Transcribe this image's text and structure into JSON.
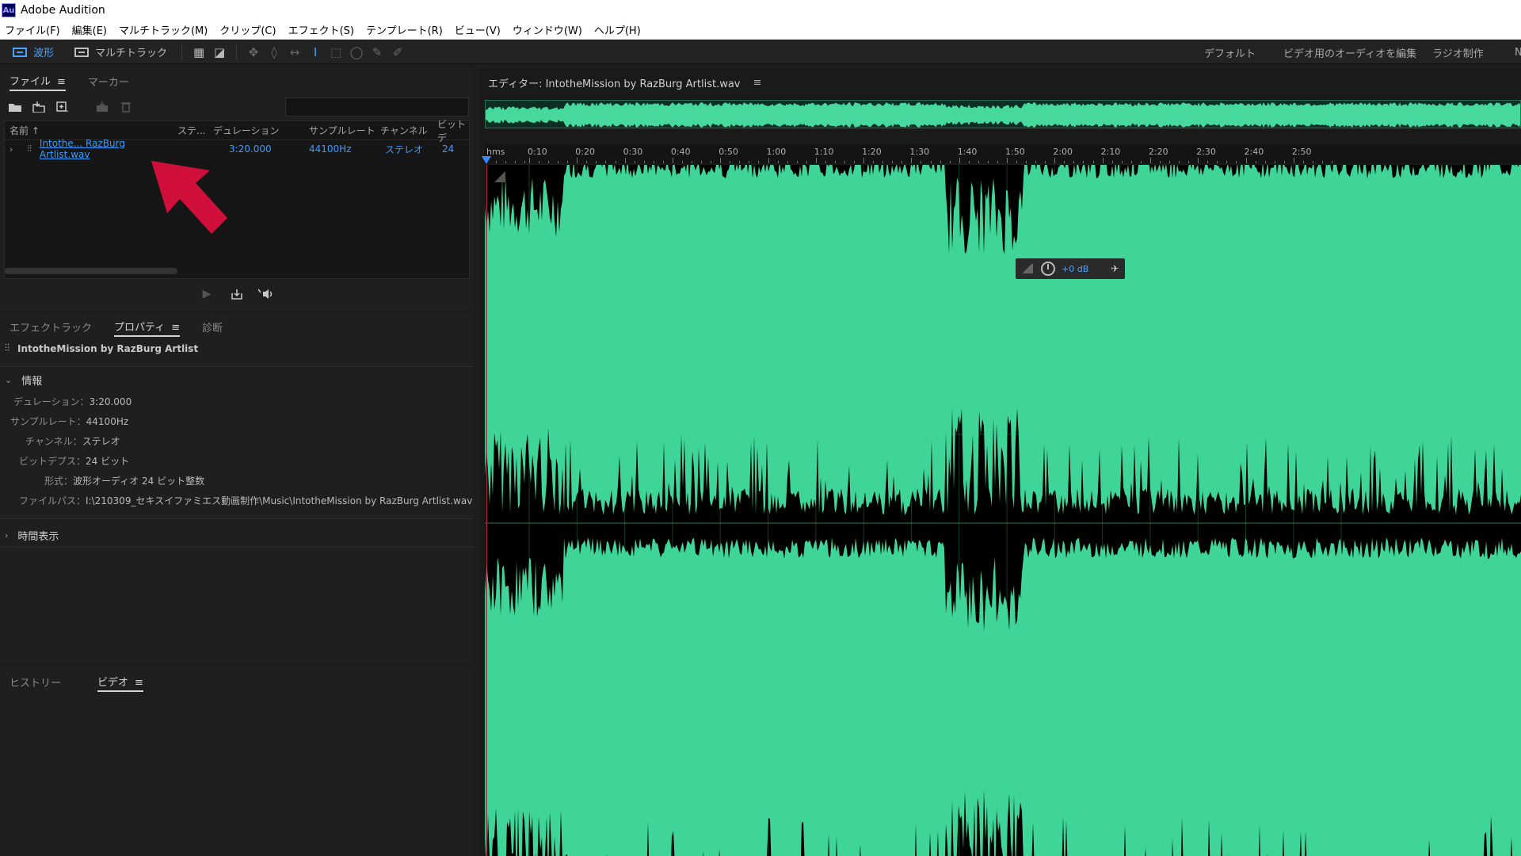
{
  "window": {
    "title": "Adobe Audition",
    "logo_text": "Au"
  },
  "menu": [
    "ファイル(F)",
    "編集(E)",
    "マルチトラック(M)",
    "クリップ(C)",
    "エフェクト(S)",
    "テンプレート(R)",
    "ビュー(V)",
    "ウィンドウ(W)",
    "ヘルプ(H)"
  ],
  "toolbar": {
    "waveform_label": "波形",
    "multitrack_label": "マルチトラック",
    "workspaces": [
      "デフォルト",
      "ビデオ用のオーディオを編集",
      "ラジオ制作",
      "N"
    ]
  },
  "files_panel": {
    "tabs": {
      "files": "ファイル",
      "markers": "マーカー"
    },
    "menu_glyph": "≡",
    "search_placeholder": "",
    "columns": {
      "name": "名前 ↑",
      "status": "ステ...",
      "duration": "デュレーション",
      "sample_rate": "サンプルレート",
      "channels": "チャンネル",
      "bit_depth": "ビットデ"
    },
    "file": {
      "name": "Intothe... RazBurg Artlist.wav",
      "duration": "3:20.000",
      "sample_rate": "44100Hz",
      "channels": "ステレオ",
      "bit_depth": "24"
    }
  },
  "props_panel": {
    "tabs": {
      "effects_rack": "エフェクトラック",
      "properties": "プロパティ",
      "diagnostics": "診断"
    },
    "title": "IntotheMission by RazBurg Artlist",
    "info_header": "情報",
    "rows": [
      {
        "label": "デュレーション：",
        "value": "3:20.000"
      },
      {
        "label": "サンプルレート：",
        "value": "44100Hz"
      },
      {
        "label": "チャンネル：",
        "value": "ステレオ"
      },
      {
        "label": "ビットデプス：",
        "value": "24 ビット"
      },
      {
        "label": "形式：",
        "value": "波形オーディオ 24 ビット整数"
      },
      {
        "label": "ファイルパス：",
        "value": "I:\\210309_セキスイファミエス動画制作\\Music\\IntotheMission by RazBurg Artlist.wav"
      }
    ],
    "time_display_header": "時間表示"
  },
  "video_panel": {
    "tabs": {
      "history": "ヒストリー",
      "video": "ビデオ"
    }
  },
  "editor": {
    "header": "エディター: IntotheMission by RazBurg Artlist.wav",
    "ruler_labels": [
      "hms",
      "0:10",
      "0:20",
      "0:30",
      "0:40",
      "0:50",
      "1:00",
      "1:10",
      "1:20",
      "1:30",
      "1:40",
      "1:50",
      "2:00",
      "2:10",
      "2:20",
      "2:30",
      "2:40",
      "2:50"
    ],
    "hud_gain": "+0 dB"
  },
  "colors": {
    "waveform": "#40d598",
    "accent": "#4aa3ff",
    "arrow": "#d0103a"
  }
}
